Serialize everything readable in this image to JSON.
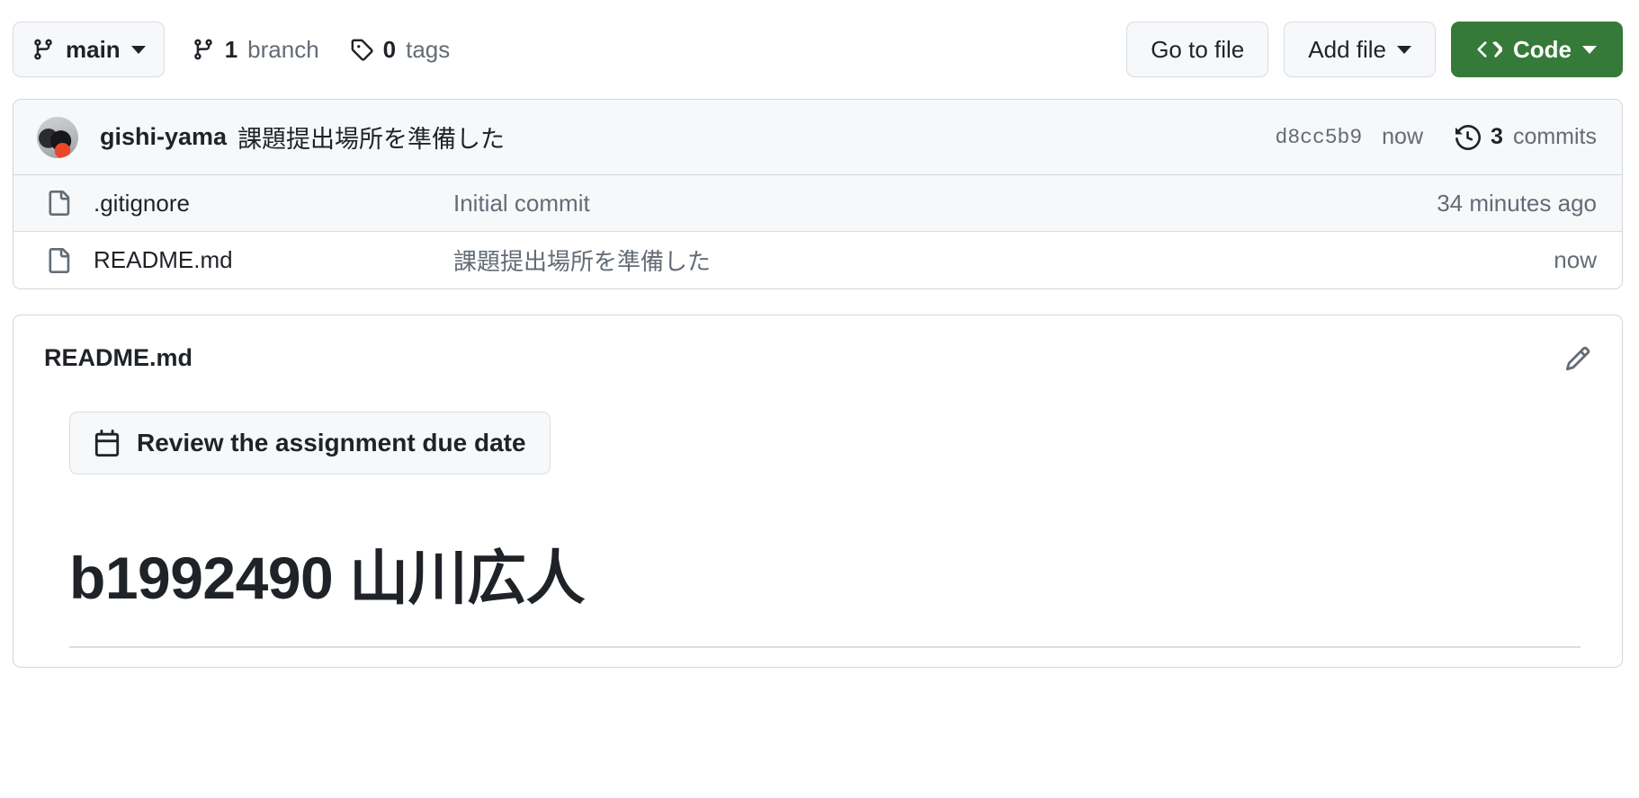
{
  "toolbar": {
    "branch_button": {
      "icon": "git-branch-icon",
      "label": "main",
      "caret": "chevron-down-icon"
    },
    "branch_count": {
      "icon": "git-branch-icon",
      "number": "1",
      "word": "branch"
    },
    "tag_count": {
      "icon": "tag-icon",
      "number": "0",
      "word": "tags"
    },
    "go_to_file_label": "Go to file",
    "add_file_label": "Add file",
    "code_label": "Code",
    "code_button_color": "#357a38"
  },
  "commit_header": {
    "author": "gishi-yama",
    "message": "課題提出場所を準備した",
    "sha": "d8cc5b9",
    "time": "now",
    "commits_number": "3",
    "commits_word": "commits"
  },
  "files": [
    {
      "icon": "file-icon",
      "name": ".gitignore",
      "message": "Initial commit",
      "time": "34 minutes ago"
    },
    {
      "icon": "file-icon",
      "name": "README.md",
      "message": "課題提出場所を準備した",
      "time": "now"
    }
  ],
  "readme": {
    "title": "README.md",
    "edit_icon": "pencil-icon",
    "due_button": {
      "icon": "calendar-icon",
      "label": "Review the assignment due date"
    },
    "heading": "b1992490 山川広人"
  }
}
